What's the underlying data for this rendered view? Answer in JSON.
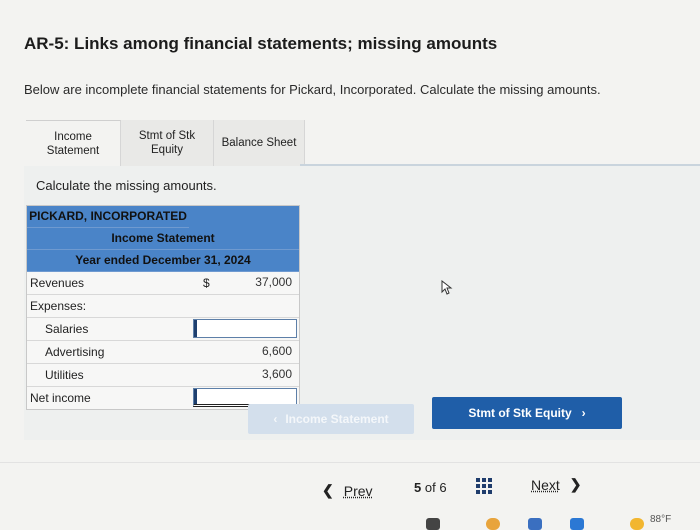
{
  "header": {
    "title": "AR-5: Links among financial statements; missing amounts",
    "intro": "Below are incomplete financial statements for Pickard, Incorporated. Calculate the missing amounts."
  },
  "tabs": [
    {
      "label": "Income\nStatement",
      "active": true
    },
    {
      "label": "Stmt of Stk\nEquity",
      "active": false
    },
    {
      "label": "Balance Sheet",
      "active": false
    }
  ],
  "panel": {
    "instruction": "Calculate the missing amounts."
  },
  "statement": {
    "company": "PICKARD, INCORPORATED",
    "name": "Income Statement",
    "period": "Year ended December 31, 2024",
    "rows": {
      "revenues": {
        "label": "Revenues",
        "currency": "$",
        "value": "37,000"
      },
      "expenses": {
        "label": "Expenses:"
      },
      "salaries": {
        "label": "Salaries",
        "value": ""
      },
      "advertising": {
        "label": "Advertising",
        "value": "6,600"
      },
      "utilities": {
        "label": "Utilities",
        "value": "3,600"
      },
      "net_income": {
        "label": "Net income",
        "value": ""
      }
    }
  },
  "buttons": {
    "prev_tab": {
      "label": "Income Statement",
      "icon": "chevron-left-icon"
    },
    "next_tab": {
      "label": "Stmt of Stk Equity",
      "icon": "chevron-right-icon"
    }
  },
  "footer": {
    "prev_label": "Prev",
    "page_current": "5",
    "page_of": "of 6",
    "next_label": "Next"
  },
  "taskbar": {
    "temperature": "88°F"
  },
  "colors": {
    "header_blue": "#4a84c8",
    "button_blue": "#1f5ea8",
    "disabled_button": "#d3dfec"
  }
}
